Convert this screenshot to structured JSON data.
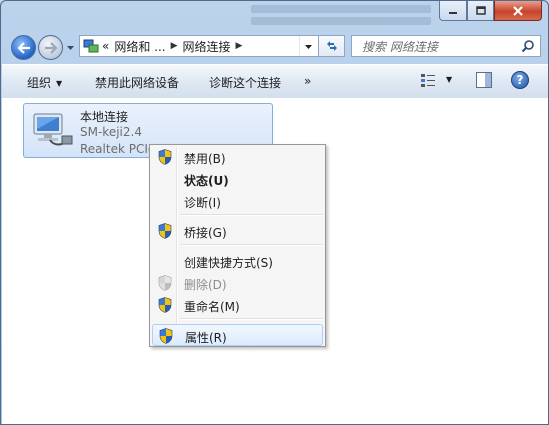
{
  "window": {
    "controls": {
      "minimize": "minimize",
      "maximize": "maximize",
      "close": "close"
    }
  },
  "nav": {
    "breadcrumb_overflow": "«",
    "breadcrumb": [
      "网络和 ...",
      "网络连接"
    ],
    "search_placeholder": "搜索 网络连接"
  },
  "toolbar": {
    "organize": "组织",
    "disable_device": "禁用此网络设备",
    "diagnose": "诊断这个连接",
    "more": "»"
  },
  "connection": {
    "name": "本地连接",
    "ssid": "SM-keji2.4",
    "device": "Realtek PCIe"
  },
  "context_menu": {
    "items": [
      {
        "label": "禁用(B)",
        "shield": true,
        "bold": false,
        "disabled": false
      },
      {
        "label": "状态(U)",
        "shield": false,
        "bold": true,
        "disabled": false
      },
      {
        "label": "诊断(I)",
        "shield": false,
        "bold": false,
        "disabled": false
      },
      {
        "label": "桥接(G)",
        "shield": true,
        "bold": false,
        "disabled": false
      },
      {
        "label": "创建快捷方式(S)",
        "shield": false,
        "bold": false,
        "disabled": false
      },
      {
        "label": "删除(D)",
        "shield": true,
        "bold": false,
        "disabled": true
      },
      {
        "label": "重命名(M)",
        "shield": true,
        "bold": false,
        "disabled": false
      },
      {
        "label": "属性(R)",
        "shield": true,
        "bold": false,
        "disabled": false,
        "highlighted": true
      }
    ]
  },
  "icons": {
    "back": "back-arrow-icon",
    "forward": "forward-arrow-icon",
    "network": "network-connections-icon",
    "refresh": "refresh-icon",
    "search": "search-icon",
    "views": "change-view-icon",
    "preview_pane": "preview-pane-icon",
    "help": "help-icon",
    "uac": "uac-shield-icon"
  },
  "colors": {
    "selection": "#d3e4f8",
    "menu_highlight": "#dcebfc",
    "shield_blue": "#2a5db0",
    "shield_yellow": "#f2c40c"
  }
}
